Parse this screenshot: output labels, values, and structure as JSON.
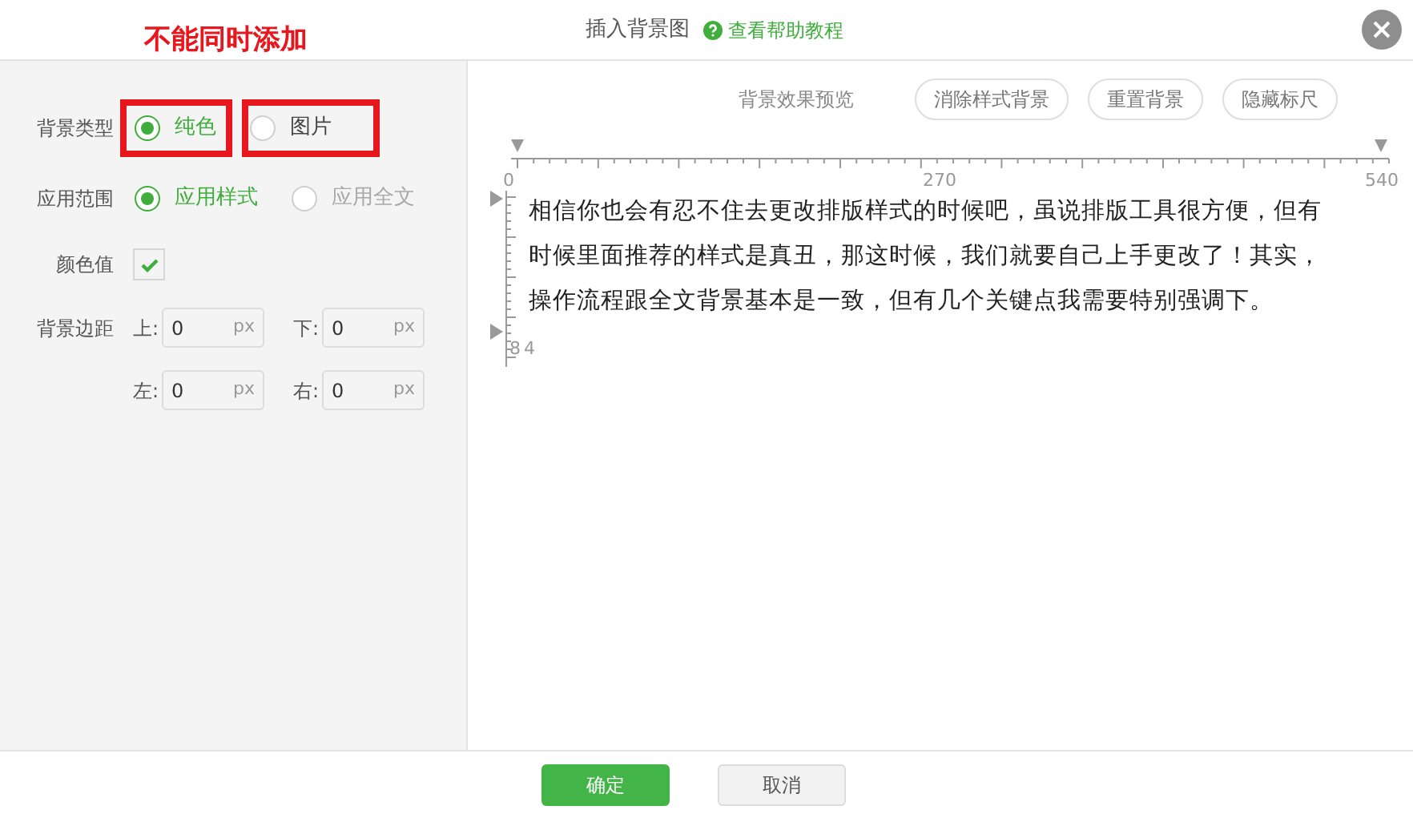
{
  "annotation": {
    "text": "不能同时添加"
  },
  "window": {
    "title": "插入背景图",
    "help_link": "查看帮助教程"
  },
  "form": {
    "background_type": {
      "label": "背景类型",
      "options": [
        {
          "label": "纯色",
          "selected": true,
          "disabled": false,
          "highlighted": true
        },
        {
          "label": "图片",
          "selected": false,
          "disabled": false,
          "highlighted": true
        }
      ]
    },
    "scope": {
      "label": "应用范围",
      "options": [
        {
          "label": "应用样式",
          "selected": true,
          "disabled": false,
          "highlighted": false
        },
        {
          "label": "应用全文",
          "selected": false,
          "disabled": true,
          "highlighted": false
        }
      ]
    },
    "color": {
      "label": "颜色值",
      "checked": true
    },
    "margin": {
      "label": "背景边距",
      "fields": [
        {
          "label": "上:",
          "value": "0",
          "unit": "px"
        },
        {
          "label": "下:",
          "value": "0",
          "unit": "px"
        },
        {
          "label": "左:",
          "value": "0",
          "unit": "px"
        },
        {
          "label": "右:",
          "value": "0",
          "unit": "px"
        }
      ]
    }
  },
  "preview": {
    "title": "背景效果预览",
    "buttons": [
      "消除样式背景",
      "重置背景",
      "隐藏标尺"
    ],
    "ruler": {
      "labels": [
        "0",
        "270",
        "540"
      ],
      "side_label": "84"
    },
    "text": [
      "相信你也会有忍不住去更改排版样式的时候吧，虽说排版工具很方便，但有",
      "时候里面推荐的样式是真丑，那这时候，我们就要自己上手更改了！其实，",
      "操作流程跟全文背景基本是一致，但有几个关键点我需要特别强调下。"
    ]
  },
  "footer": {
    "confirm": "确定",
    "cancel": "取消"
  }
}
